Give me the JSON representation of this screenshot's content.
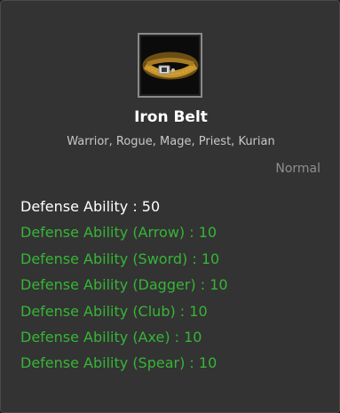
{
  "item": {
    "icon": "iron-belt-icon",
    "name": "Iron Belt",
    "classes": "Warrior, Rogue, Mage, Priest, Kurian",
    "grade": "Normal"
  },
  "stats": [
    {
      "text": "Defense Ability : 50",
      "color": "#ffffff"
    },
    {
      "text": "Defense Ability (Arrow) : 10",
      "color": "#36b536"
    },
    {
      "text": "Defense Ability (Sword) : 10",
      "color": "#36b536"
    },
    {
      "text": "Defense Ability (Dagger) : 10",
      "color": "#36b536"
    },
    {
      "text": "Defense Ability (Club) : 10",
      "color": "#36b536"
    },
    {
      "text": "Defense Ability (Axe) : 10",
      "color": "#36b536"
    },
    {
      "text": "Defense Ability (Spear) : 10",
      "color": "#36b536"
    }
  ]
}
